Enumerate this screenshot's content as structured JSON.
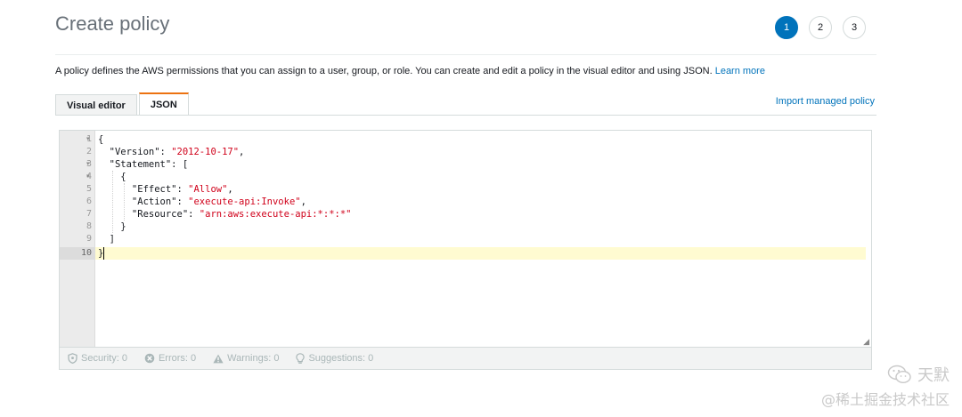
{
  "header": {
    "title": "Create policy"
  },
  "steps": [
    "1",
    "2",
    "3"
  ],
  "description": {
    "text": "A policy defines the AWS permissions that you can assign to a user, group, or role. You can create and edit a policy in the visual editor and using JSON.",
    "link": "Learn more"
  },
  "tabs": [
    {
      "label": "Visual editor",
      "active": false
    },
    {
      "label": "JSON",
      "active": true
    }
  ],
  "import_link": "Import managed policy",
  "editor": {
    "line_numbers": [
      "1",
      "2",
      "3",
      "4",
      "5",
      "6",
      "7",
      "8",
      "9",
      "10"
    ],
    "current_line": 10,
    "lines": [
      "{",
      "  \"Version\": \"2012-10-17\",",
      "  \"Statement\": [",
      "    {",
      "      \"Effect\": \"Allow\",",
      "      \"Action\": \"execute-api:Invoke\",",
      "      \"Resource\": \"arn:aws:execute-api:*:*:*\"",
      "    }",
      "  ]",
      "}"
    ]
  },
  "status": {
    "security": "Security: 0",
    "errors": "Errors: 0",
    "warnings": "Warnings: 0",
    "suggestions": "Suggestions: 0"
  },
  "watermark": {
    "top": "天默",
    "bottom": "@稀土掘金技术社区"
  },
  "colors": {
    "accent": "#0073bb",
    "tab_active_border": "#ec7211",
    "string": "#d0021b",
    "active_line": "#fffbd1"
  }
}
